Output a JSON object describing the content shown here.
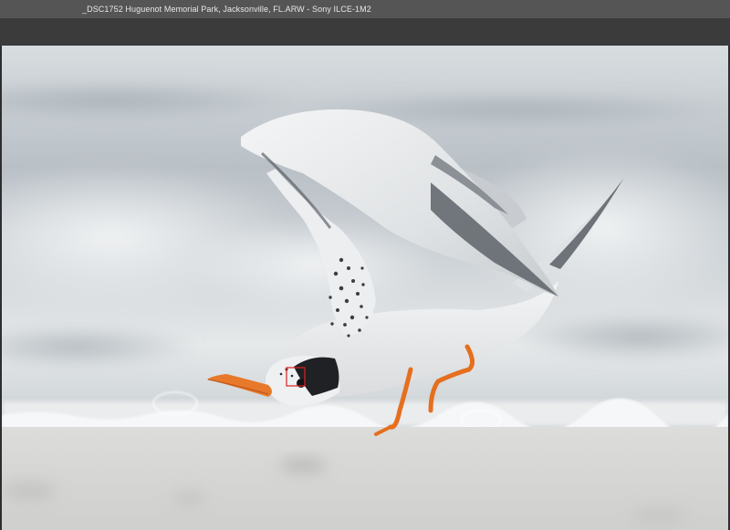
{
  "window": {
    "title": "_DSC1752 Huguenot Memorial Park, Jacksonville, FL.ARW  -  Sony ILCE-1M2"
  },
  "photo": {
    "subject": "tern",
    "focus_point_color": "#e02020"
  },
  "colors": {
    "titlebar_bg": "#555555",
    "toolbar_bg": "#3b3b3b",
    "sand": "#d9d9d7",
    "water": "#c9ced3",
    "beak_orange": "#e8782a",
    "legs_orange": "#e66f1f"
  }
}
